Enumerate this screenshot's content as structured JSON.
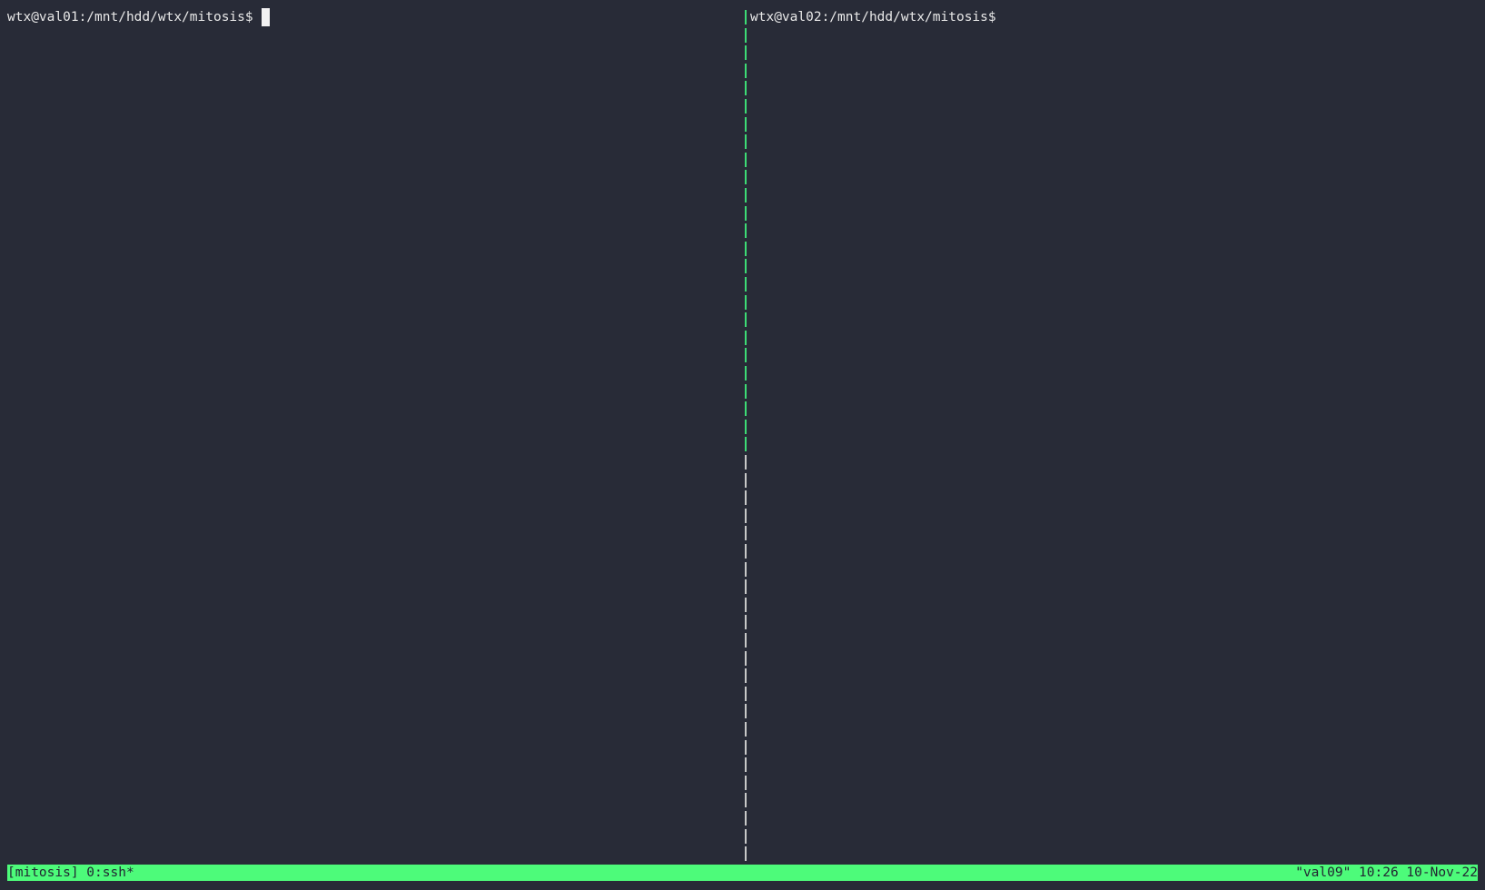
{
  "terminal": {
    "left_pane": {
      "prompt": "wtx@val01:/mnt/hdd/wtx/mitosis$"
    },
    "right_pane": {
      "prompt": "wtx@val02:/mnt/hdd/wtx/mitosis$"
    },
    "status_bar": {
      "left": "[mitosis] 0:ssh*",
      "right": "\"val09\" 10:26 10-Nov-22"
    }
  },
  "colors": {
    "background": "#282b37",
    "text": "#e8e8e8",
    "status_bar_bg": "#4dfb7a",
    "status_bar_text": "#222632",
    "divider_active": "#3ddc75",
    "divider_inactive": "#c8c8c8"
  }
}
